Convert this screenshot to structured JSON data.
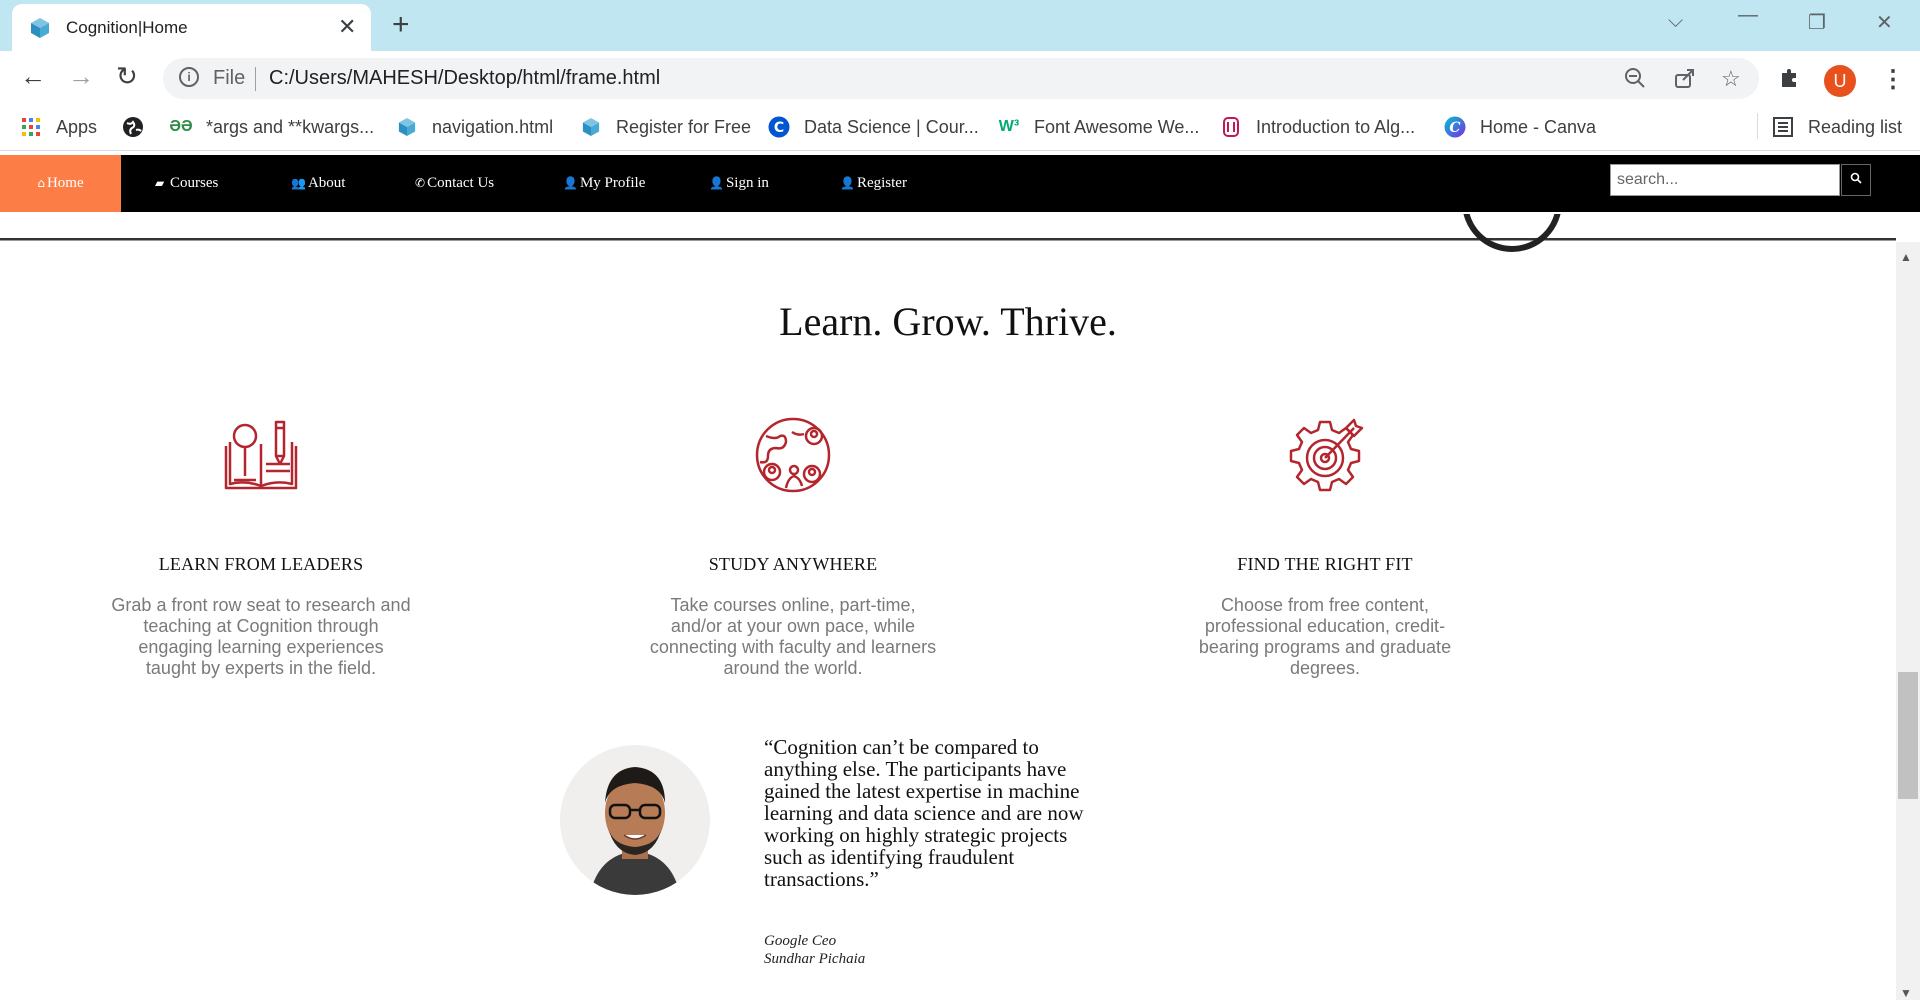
{
  "browser": {
    "tab_title": "Cognition|Home",
    "address_scheme": "File",
    "address_url": "C:/Users/MAHESH/Desktop/html/frame.html",
    "bookmarks": [
      {
        "label": "Apps",
        "icon": "apps-grid-icon"
      },
      {
        "label": "",
        "icon": "globe-icon"
      },
      {
        "label": "*args and **kwargs...",
        "icon": "geeksforgeeks-icon"
      },
      {
        "label": "navigation.html",
        "icon": "cube-icon"
      },
      {
        "label": "Register for Free",
        "icon": "cube-icon"
      },
      {
        "label": "Data Science | Cour...",
        "icon": "coursera-icon"
      },
      {
        "label": "Font Awesome We...",
        "icon": "w3schools-icon"
      },
      {
        "label": "Introduction to Alg...",
        "icon": "mit-icon"
      },
      {
        "label": "Home - Canva",
        "icon": "canva-icon"
      }
    ],
    "reading_list": "Reading list",
    "profile_initial": "U"
  },
  "site": {
    "nav": [
      {
        "label": "Home",
        "icon": "home-icon",
        "active": true
      },
      {
        "label": "Courses",
        "icon": "book-icon"
      },
      {
        "label": "About",
        "icon": "users-icon"
      },
      {
        "label": "Contact Us",
        "icon": "phone-icon"
      },
      {
        "label": "My Profile",
        "icon": "user-icon"
      },
      {
        "label": "Sign in",
        "icon": "user-plus-icon"
      },
      {
        "label": "Register",
        "icon": "user-icon"
      }
    ],
    "search_placeholder": "search...",
    "headline": "Learn. Grow. Thrive.",
    "features": [
      {
        "title": "LEARN FROM LEADERS",
        "text": "Grab a front row seat to research and teaching at Cognition through engaging learning experiences taught by experts in the field.",
        "icon": "book-research-icon"
      },
      {
        "title": "STUDY ANYWHERE",
        "text": "Take courses online, part-time, and/or at your own pace, while connecting with faculty and learners around the world.",
        "icon": "globe-people-icon"
      },
      {
        "title": "FIND THE RIGHT FIT",
        "text": "Choose from free content, professional education, credit-bearing programs and graduate degrees.",
        "icon": "gear-target-icon"
      }
    ],
    "testimonial": {
      "quote": "“Cognition can’t be compared to anything else. The participants have gained the latest expertise in machine learning and data science and are now working on highly strategic projects such as identifying fraudulent transactions.”",
      "role": "Google Ceo",
      "name": "Sundhar Pichaia"
    }
  },
  "colors": {
    "accent": "#fd7d47",
    "icon_red": "#b3262e",
    "nav_bg": "#000000",
    "tabstrip": "#bfe6f1",
    "muted_text": "#7a7a7a"
  }
}
